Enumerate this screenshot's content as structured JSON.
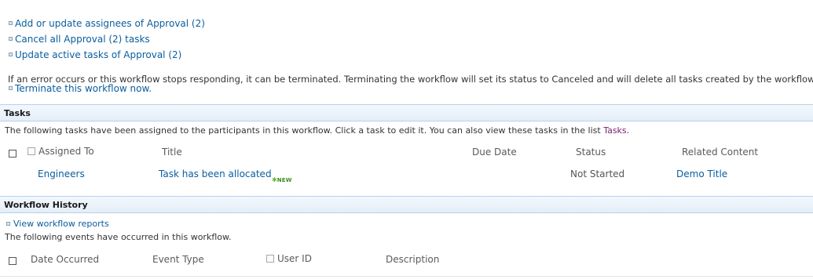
{
  "actions": [
    {
      "label": "Add or update assignees of Approval (2)"
    },
    {
      "label": "Cancel all Approval (2) tasks"
    },
    {
      "label": "Update active tasks of Approval (2)"
    }
  ],
  "terminate": {
    "message": "If an error occurs or this workflow stops responding, it can be terminated. Terminating the workflow will set its status to Canceled and will delete all tasks created by the workflow.",
    "link_label": "Terminate this workflow now."
  },
  "tasks": {
    "title": "Tasks",
    "description_prefix": "The following tasks have been assigned to the participants in this workflow. Click a task to edit it. You can also view these tasks in the list",
    "list_link": "Tasks",
    "description_suffix": ".",
    "columns": {
      "assigned_to": "Assigned To",
      "title": "Title",
      "due_date": "Due Date",
      "status": "Status",
      "related_content": "Related Content"
    },
    "rows": [
      {
        "assigned_to": "Engineers",
        "title": "Task has been allocated",
        "new_badge": "NEW",
        "due_date": "",
        "status": "Not Started",
        "related_content": "Demo Title"
      }
    ]
  },
  "history": {
    "title": "Workflow History",
    "reports_link": "View workflow reports",
    "description": "The following events have occurred in this workflow.",
    "columns": {
      "date_occurred": "Date Occurred",
      "event_type": "Event Type",
      "user_id": "User ID",
      "description": "Description"
    }
  },
  "colors": {
    "link": "#0a5d9e",
    "list_link": "#7a1b6e",
    "header_bg": "#e4eef8",
    "header_border": "#b8d1ea",
    "new_badge": "#3a8f1e"
  },
  "icons": [
    "bullet-icon",
    "checkbox-icon",
    "new-star-icon"
  ]
}
